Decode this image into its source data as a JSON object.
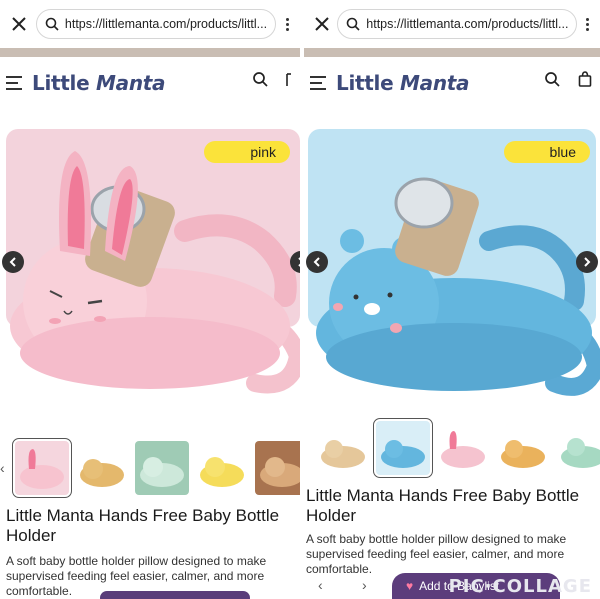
{
  "left": {
    "url": "https://littlemanta.com/products/littl...",
    "logo": {
      "word1": "Little",
      "word2": "Manta"
    },
    "color_tag": "pink",
    "title": "Little Manta Hands Free Baby Bottle Holder",
    "description": "A soft baby bottle holder pillow designed to make supervised feeding feel easier, calmer, and more comfortable.",
    "thumb_colors": [
      "pink",
      "tan",
      "green",
      "yellow",
      "brown"
    ]
  },
  "right": {
    "url": "https://littlemanta.com/products/littl...",
    "logo": {
      "word1": "Little",
      "word2": "Manta"
    },
    "color_tag": "blue",
    "title": "Little Manta Hands Free Baby Bottle Holder",
    "description": "A soft baby bottle holder pillow designed to make supervised feeding feel easier, calmer, and more comfortable.",
    "add_button": "Add to Babylist",
    "thumb_colors": [
      "tan",
      "blue",
      "pink",
      "orange",
      "green"
    ]
  },
  "watermark": "PIC·COLLAGE",
  "colors": {
    "brand_blue": "#3d4a7a",
    "pink_bg": "#f3d3dc",
    "blue_bg": "#bfe3f3",
    "tag_yellow": "#fbe33a",
    "band": "#c9bdb3",
    "button_purple": "#5c3d7c"
  },
  "icons": [
    "close-icon",
    "search-icon",
    "more-icon",
    "menu-icon",
    "cart-icon",
    "chevron-left-icon",
    "chevron-right-icon"
  ]
}
